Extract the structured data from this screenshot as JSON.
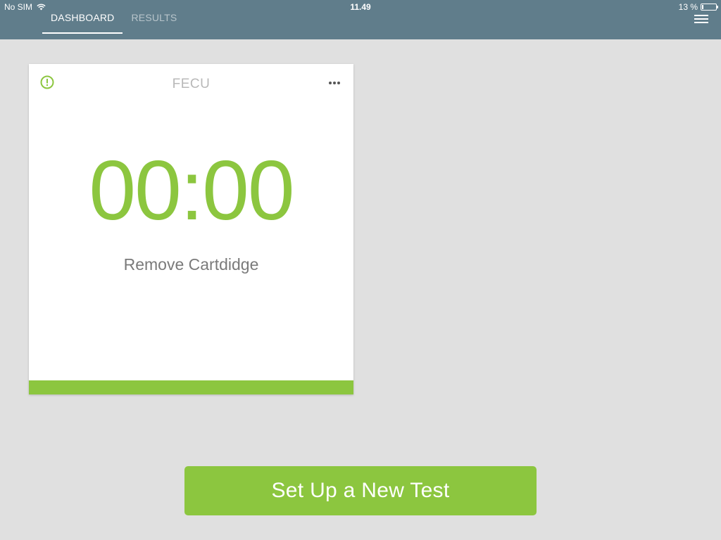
{
  "status_bar": {
    "carrier": "No SIM",
    "time": "11.49",
    "battery_text": "13 %",
    "battery_level": 0.13
  },
  "nav": {
    "tabs": [
      {
        "label": "DASHBOARD",
        "active": true
      },
      {
        "label": "RESULTS",
        "active": false
      }
    ],
    "menu_icon": "hamburger-menu-icon"
  },
  "card": {
    "title": "FECU",
    "alert_icon": "alert-circle-icon",
    "more_icon": "more-horizontal-icon",
    "timer": "00:00",
    "status": "Remove Cartdidge",
    "progress": 1.0
  },
  "primary_action": {
    "label": "Set Up a New Test"
  },
  "colors": {
    "topbar": "#607d8b",
    "accent": "#8cc63f",
    "background": "#e0e0e0"
  }
}
